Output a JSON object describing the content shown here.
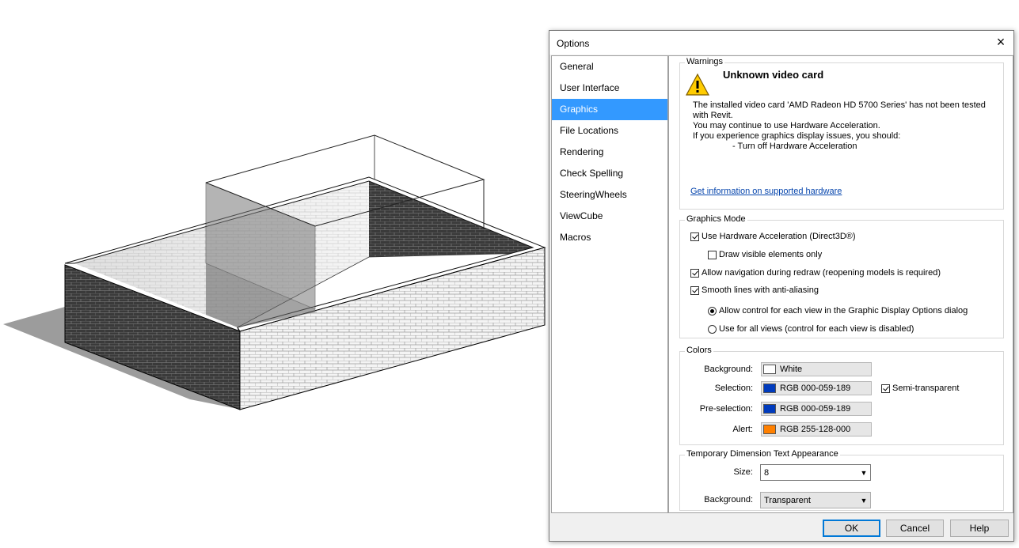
{
  "dialog": {
    "title": "Options",
    "close_glyph": "×"
  },
  "nav": {
    "items": [
      {
        "label": "General"
      },
      {
        "label": "User Interface"
      },
      {
        "label": "Graphics"
      },
      {
        "label": "File Locations"
      },
      {
        "label": "Rendering"
      },
      {
        "label": "Check Spelling"
      },
      {
        "label": "SteeringWheels"
      },
      {
        "label": "ViewCube"
      },
      {
        "label": "Macros"
      }
    ],
    "selected": "Graphics"
  },
  "warnings": {
    "group_title": "Warnings",
    "icon": "warning-icon",
    "title": "Unknown video card",
    "lines": [
      "The installed video card 'AMD Radeon HD 5700 Series' has not been tested",
      "with Revit.",
      "You may continue to use Hardware Acceleration.",
      "If you experience graphics display issues, you should:",
      "- Turn off Hardware Acceleration"
    ],
    "link": "Get information on supported hardware"
  },
  "graphics_mode": {
    "group_title": "Graphics Mode",
    "hardware_acceleration": {
      "label": "Use Hardware Acceleration (Direct3D®)",
      "checked": true
    },
    "draw_visible": {
      "label": "Draw visible elements only",
      "checked": false
    },
    "allow_navigation": {
      "label": "Allow navigation during redraw (reopening models is required)",
      "checked": true
    },
    "smooth_lines": {
      "label": "Smooth lines with anti-aliasing",
      "checked": true
    },
    "radio_allow_control": {
      "label": "Allow control for each view in the Graphic Display Options dialog",
      "selected": true
    },
    "radio_use_all": {
      "label": "Use for all views (control for each view is disabled)",
      "selected": false
    }
  },
  "colors": {
    "group_title": "Colors",
    "background": {
      "label": "Background:",
      "value": "White",
      "color": "#ffffff"
    },
    "selection": {
      "label": "Selection:",
      "value": "RGB 000-059-189",
      "color": "#003bbd"
    },
    "semi_transparent": {
      "label": "Semi-transparent",
      "checked": true
    },
    "preselection": {
      "label": "Pre-selection:",
      "value": "RGB 000-059-189",
      "color": "#003bbd"
    },
    "alert": {
      "label": "Alert:",
      "value": "RGB 255-128-000",
      "color": "#ff8000"
    }
  },
  "temp_dim": {
    "group_title": "Temporary Dimension Text Appearance",
    "size_label": "Size:",
    "size_value": "8",
    "background_label": "Background:",
    "background_value": "Transparent"
  },
  "buttons": {
    "ok": "OK",
    "cancel": "Cancel",
    "help": "Help"
  }
}
